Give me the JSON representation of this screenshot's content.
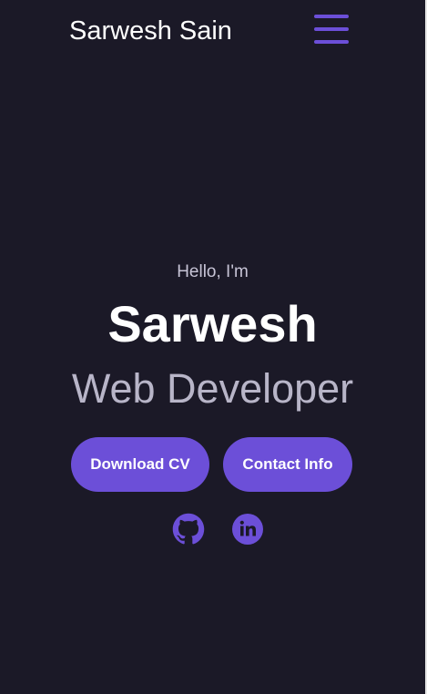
{
  "header": {
    "brand": "Sarwesh Sain",
    "menu_icon": "hamburger-menu-icon"
  },
  "hero": {
    "greeting": "Hello, I'm",
    "name": "Sarwesh",
    "role": "Web Developer"
  },
  "buttons": {
    "download_cv": "Download CV",
    "contact_info": "Contact Info"
  },
  "social": [
    {
      "icon": "github-icon"
    },
    {
      "icon": "linkedin-icon"
    }
  ],
  "colors": {
    "background": "#1b1927",
    "accent": "#6c4fd8",
    "text_primary": "#ffffff",
    "text_secondary": "#b8b5c8"
  }
}
